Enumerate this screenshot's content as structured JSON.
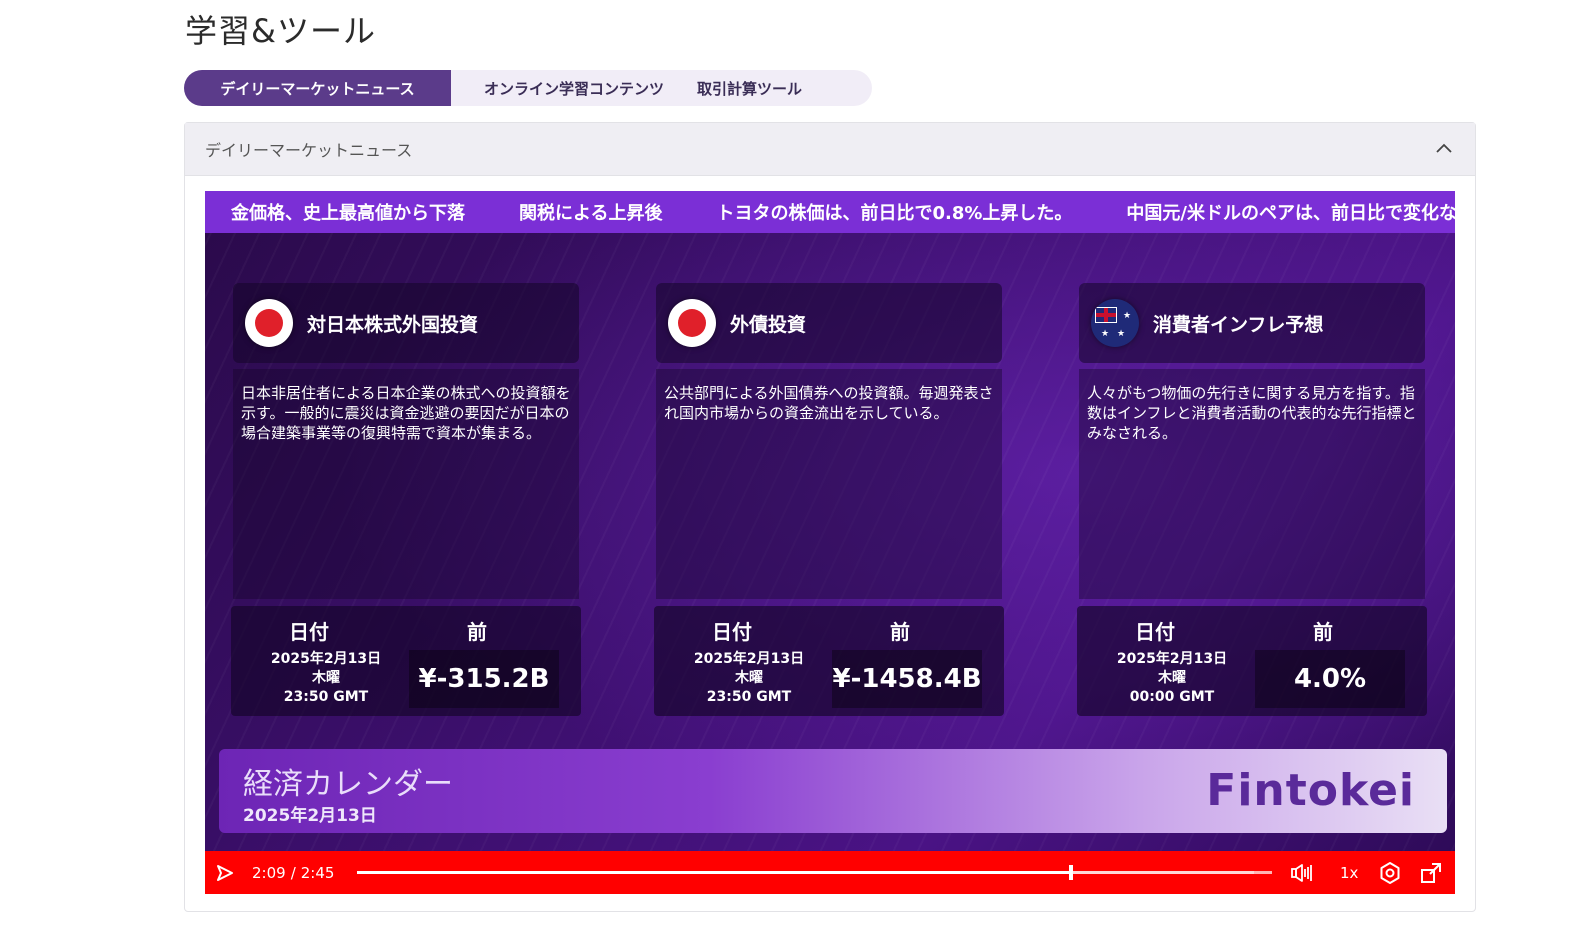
{
  "page": {
    "title": "学習&ツール"
  },
  "tabs": [
    {
      "label": "デイリーマーケットニュース",
      "active": true
    },
    {
      "label": "オンライン学習コンテンツ",
      "active": false
    },
    {
      "label": "取引計算ツール",
      "active": false
    }
  ],
  "panel": {
    "header": "デイリーマーケットニュース"
  },
  "video": {
    "ticker": [
      "金価格、史上最高値から下落",
      "関税による上昇後",
      "トヨタの株価は、前日比で0.8%上昇した。",
      "中国元/米ドルのペアは、前日比で変化な"
    ],
    "cards": [
      {
        "flag": "japan-flag",
        "title": "対日本株式外国投資",
        "description": "日本非居住者による日本企業の株式への投資額を示す。一般的に震災は資金逃避の要因だが日本の場合建築事業等の復興特需で資本が集まる。",
        "date_label": "日付",
        "prev_label": "前",
        "date": "2025年2月13日",
        "weekday": "木曜",
        "time": "23:50 GMT",
        "value": "¥-315.2B"
      },
      {
        "flag": "japan-flag",
        "title": "外債投資",
        "description": "公共部門による外国債券への投資額。毎週発表され国内市場からの資金流出を示している。",
        "date_label": "日付",
        "prev_label": "前",
        "date": "2025年2月13日",
        "weekday": "木曜",
        "time": "23:50 GMT",
        "value": "¥-1458.4B"
      },
      {
        "flag": "australia-flag",
        "title": "消費者インフレ予想",
        "description": "人々がもつ物価の先行きに関する見方を指す。指数はインフレと消費者活動の代表的な先行指標とみなされる。",
        "date_label": "日付",
        "prev_label": "前",
        "date": "2025年2月13日",
        "weekday": "木曜",
        "time": "00:00 GMT",
        "value": "4.0%"
      }
    ],
    "banner": {
      "title": "経済カレンダー",
      "date": "2025年2月13日",
      "logo": "Fintokei"
    },
    "controls": {
      "current_time": "2:09",
      "separator": "/",
      "duration": "2:45",
      "progress_fraction": 0.78,
      "buffered_fraction": 0.98,
      "speed": "1x"
    }
  },
  "colors": {
    "accent": "#5b3b8a",
    "ticker": "#7b2fd6",
    "control_bar": "#ff0000"
  }
}
